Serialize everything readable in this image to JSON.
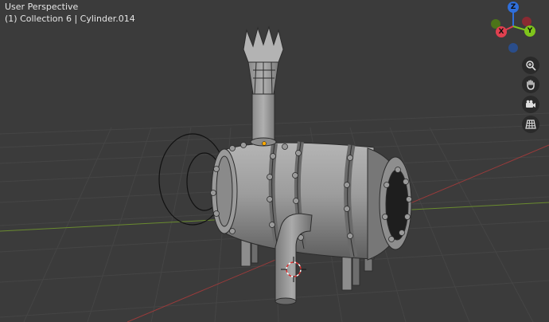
{
  "viewport": {
    "view_name": "User Perspective",
    "collection_info": "(1) Collection 6 | Cylinder.014"
  },
  "gizmo": {
    "axes": [
      {
        "name": "Z",
        "color": "#2f6fdb"
      },
      {
        "name": "X",
        "color": "#e0404f"
      },
      {
        "name": "Y",
        "color": "#7fc51c"
      }
    ],
    "negative_colors": [
      "#8a2a32",
      "#4c7419",
      "#2a4d8a"
    ]
  },
  "nav_buttons": [
    {
      "icon": "zoom-icon"
    },
    {
      "icon": "hand-icon"
    },
    {
      "icon": "camera-icon"
    },
    {
      "icon": "grid-icon"
    }
  ],
  "colors": {
    "background": "#3b3b3b",
    "grid_line": "#444444",
    "x_axis_line": "#9a3b3b",
    "y_axis_line": "#6a8b2f",
    "model_gray": "#9a9a9a",
    "origin_dot": "#ffaa00"
  }
}
